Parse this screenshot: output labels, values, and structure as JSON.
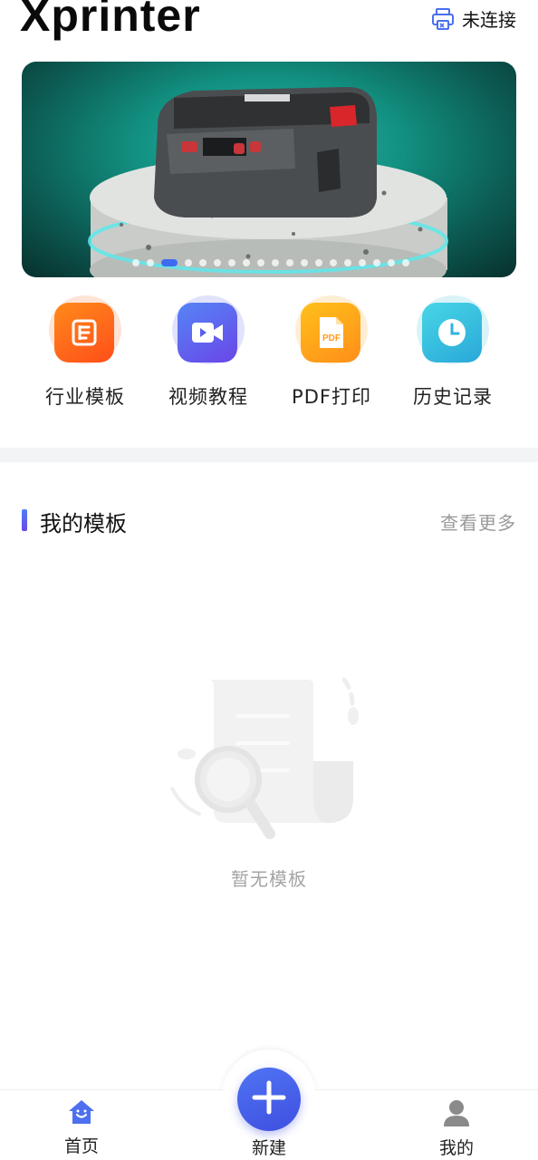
{
  "header": {
    "brand": "Xprinter",
    "connection_status": "未连接",
    "printer_icon": "printer-disconnected-icon"
  },
  "banner": {
    "slide_count": 19,
    "active_index": 2,
    "image": "portable-label-printer-on-pedestal",
    "colors": {
      "active_dot": "#3d6cf2"
    }
  },
  "quick_actions": [
    {
      "label": "行业模板",
      "icon": "template-list-icon",
      "color": "#ff6a1a"
    },
    {
      "label": "视频教程",
      "icon": "video-camera-icon",
      "color": "#5b5cf0"
    },
    {
      "label": "PDF打印",
      "icon": "pdf-file-icon",
      "color": "#ffa21a"
    },
    {
      "label": "历史记录",
      "icon": "clock-icon",
      "color": "#2fbfe0"
    }
  ],
  "my_templates": {
    "title": "我的模板",
    "more_label": "查看更多",
    "empty_text": "暂无模板",
    "empty_icon": "empty-document-search-icon"
  },
  "tabbar": {
    "items": [
      {
        "label": "首页",
        "icon": "home-icon",
        "active": true
      },
      {
        "label": "新建",
        "icon": "plus-icon",
        "active": false
      },
      {
        "label": "我的",
        "icon": "user-icon",
        "active": false
      }
    ],
    "colors": {
      "accent": "#4466ee"
    }
  }
}
